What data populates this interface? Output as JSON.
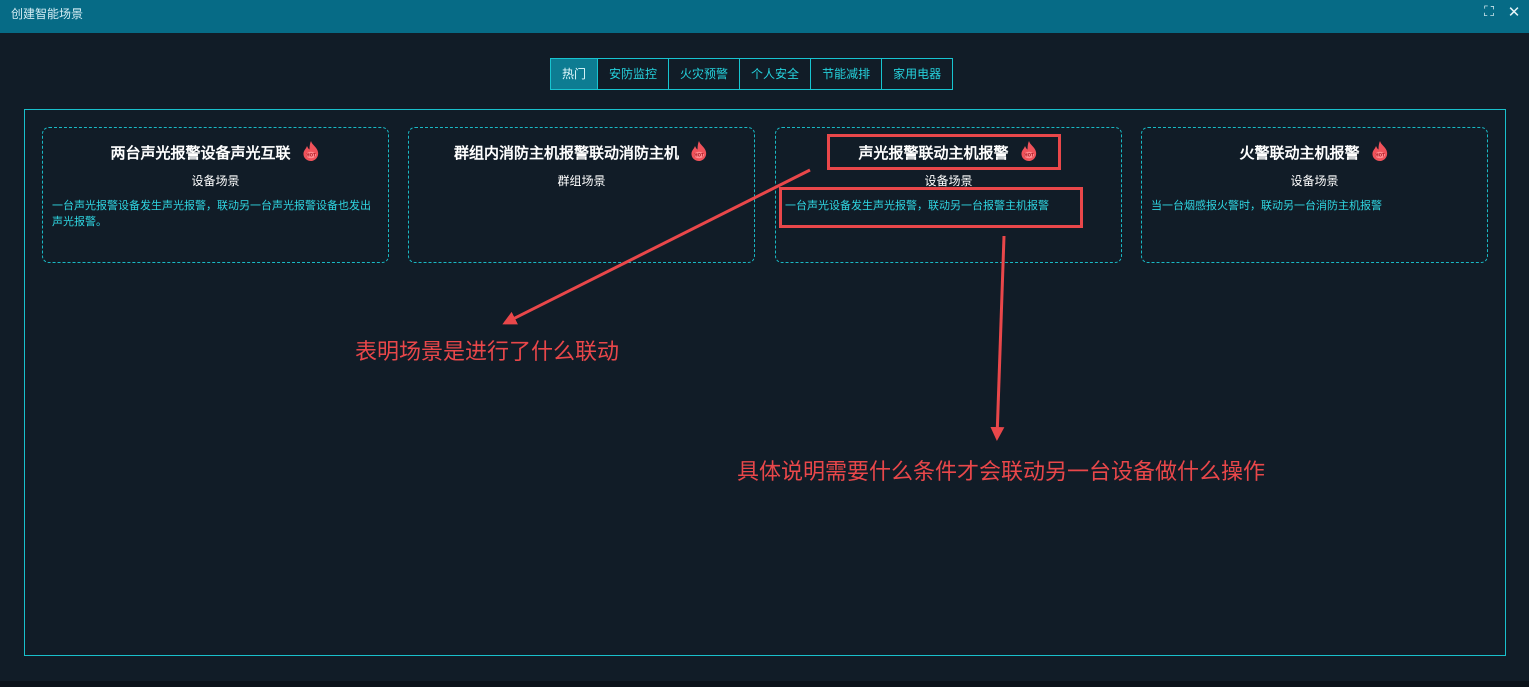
{
  "window": {
    "title": "创建智能场景",
    "maximize_icon": "expand-icon",
    "close_icon": "close-icon"
  },
  "tabs": [
    {
      "label": "热门",
      "active": true
    },
    {
      "label": "安防监控",
      "active": false
    },
    {
      "label": "火灾预警",
      "active": false
    },
    {
      "label": "个人安全",
      "active": false
    },
    {
      "label": "节能减排",
      "active": false
    },
    {
      "label": "家用电器",
      "active": false
    }
  ],
  "cards": [
    {
      "title": "两台声光报警设备声光互联",
      "type": "设备场景",
      "description": "一台声光报警设备发生声光报警，联动另一台声光报警设备也发出声光报警。",
      "badge_icon": "hot-fire-icon"
    },
    {
      "title": "群组内消防主机报警联动消防主机",
      "type": "群组场景",
      "description": "",
      "badge_icon": "hot-fire-icon"
    },
    {
      "title": "声光报警联动主机报警",
      "type": "设备场景",
      "description": "一台声光设备发生声光报警，联动另一台报警主机报警",
      "badge_icon": "hot-fire-icon"
    },
    {
      "title": "火警联动主机报警",
      "type": "设备场景",
      "description": "当一台烟感报火警时，联动另一台消防主机报警",
      "badge_icon": "hot-fire-icon"
    }
  ],
  "annotations": {
    "title_note": "表明场景是进行了什么联动",
    "desc_note": "具体说明需要什么条件才会联动另一台设备做什么操作",
    "color": "#e9474a"
  },
  "colors": {
    "titlebar": "#066b86",
    "accent": "#17c4d0",
    "background": "#111c27"
  }
}
